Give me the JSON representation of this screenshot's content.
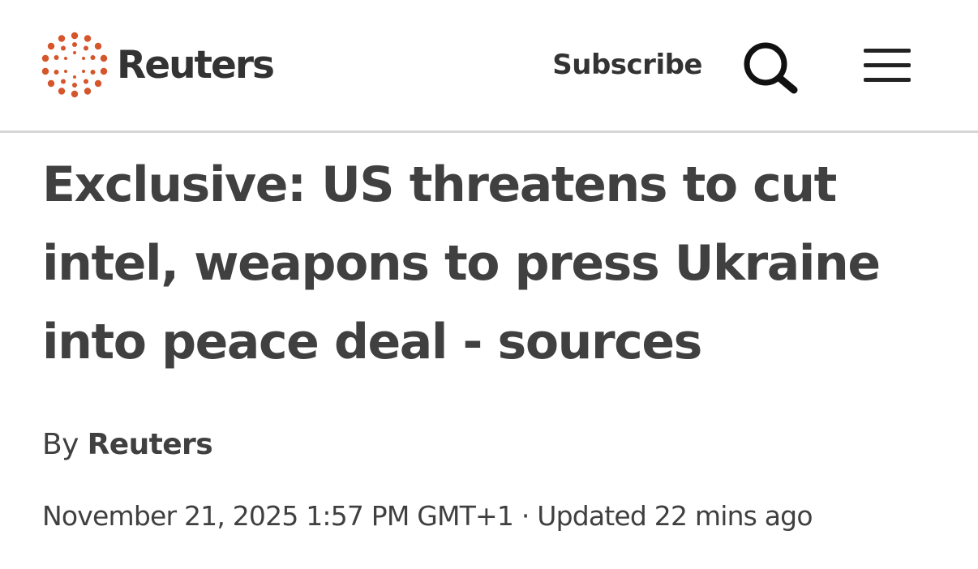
{
  "header": {
    "logo_text": "Reuters",
    "logo_icon": "reuters-dot-ring-logo",
    "subscribe_label": "Subscribe",
    "search_icon": "search-icon",
    "menu_icon": "hamburger-menu-icon"
  },
  "article": {
    "headline": "Exclusive: US threatens to cut intel, weapons to press Ukraine into peace deal - sources",
    "byline_prefix": "By",
    "author": "Reuters",
    "published": "November 21, 2025 1:57 PM GMT+1",
    "separator": "·",
    "updated": "Updated 22 mins ago"
  },
  "colors": {
    "brand_orange": "#d4562a",
    "text_dark": "#404040",
    "divider": "#d6d6d6",
    "background": "#ffffff"
  }
}
